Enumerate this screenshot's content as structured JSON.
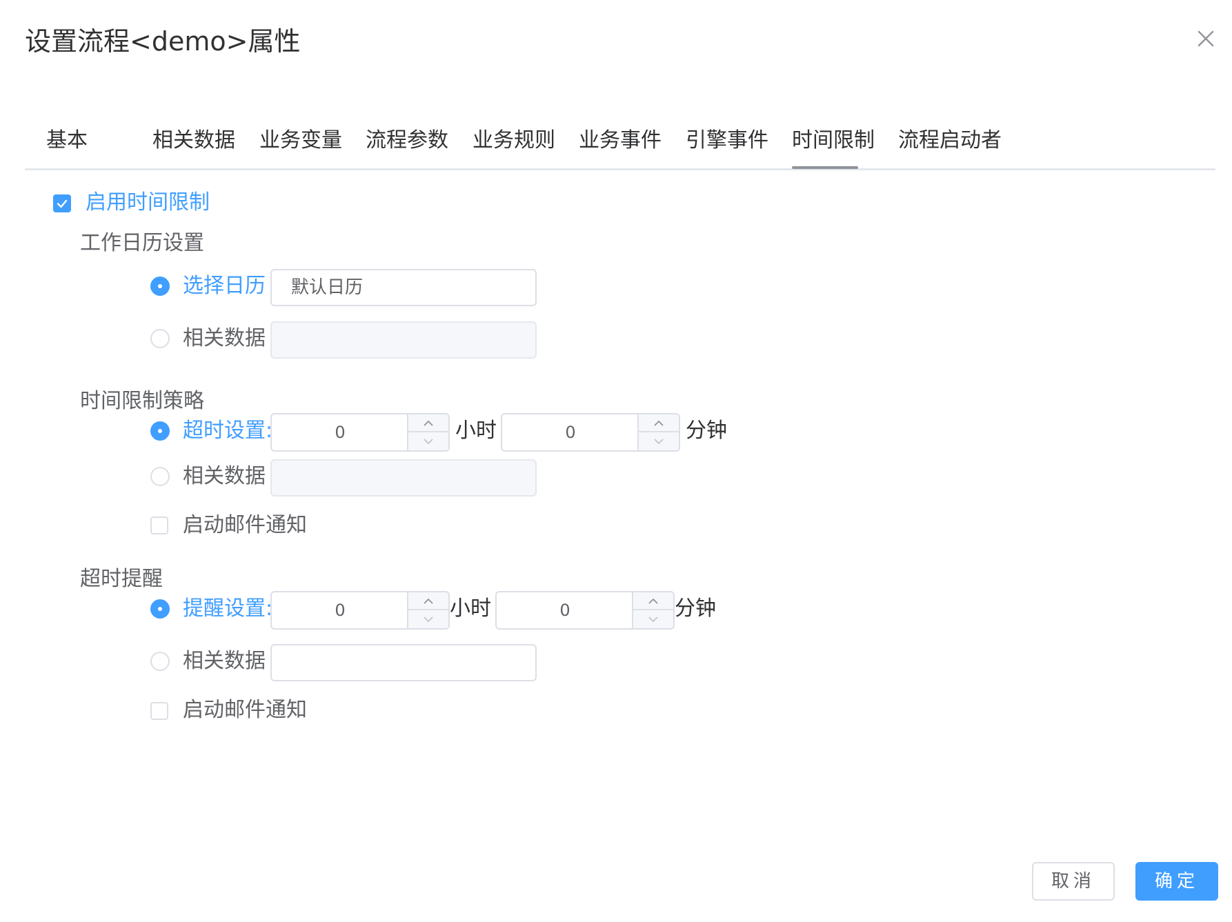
{
  "dialog": {
    "title": "设置流程<demo>属性"
  },
  "tabs": [
    {
      "label": "基本"
    },
    {
      "label": "相关数据"
    },
    {
      "label": "业务变量"
    },
    {
      "label": "流程参数"
    },
    {
      "label": "业务规则"
    },
    {
      "label": "业务事件"
    },
    {
      "label": "引擎事件"
    },
    {
      "label": "时间限制"
    },
    {
      "label": "流程启动者"
    }
  ],
  "active_tab": "时间限制",
  "enable_time_limit": {
    "label": "启用时间限制",
    "checked": true
  },
  "calendar": {
    "section_title": "工作日历设置",
    "select_calendar": {
      "label": "选择日历",
      "selected": true,
      "value": "默认日历"
    },
    "related_data": {
      "label": "相关数据",
      "selected": false,
      "value": ""
    }
  },
  "strategy": {
    "section_title": "时间限制策略",
    "timeout": {
      "label": "超时设置:",
      "selected": true,
      "hours": "0",
      "hours_unit": "小时",
      "minutes": "0",
      "minutes_unit": "分钟"
    },
    "related_data": {
      "label": "相关数据",
      "selected": false,
      "value": ""
    },
    "email": {
      "label": "启动邮件通知",
      "checked": false
    }
  },
  "reminder": {
    "section_title": "超时提醒",
    "remind": {
      "label": "提醒设置:",
      "selected": true,
      "hours": "0",
      "hours_unit": "小时",
      "minutes": "0",
      "minutes_unit": "分钟"
    },
    "related_data": {
      "label": "相关数据",
      "selected": false,
      "value": ""
    },
    "email": {
      "label": "启动邮件通知",
      "checked": false
    }
  },
  "footer": {
    "cancel_label": "取消",
    "ok_label": "确定"
  },
  "colors": {
    "accent": "#409eff",
    "text": "#303133",
    "border": "#dcdfe6"
  }
}
